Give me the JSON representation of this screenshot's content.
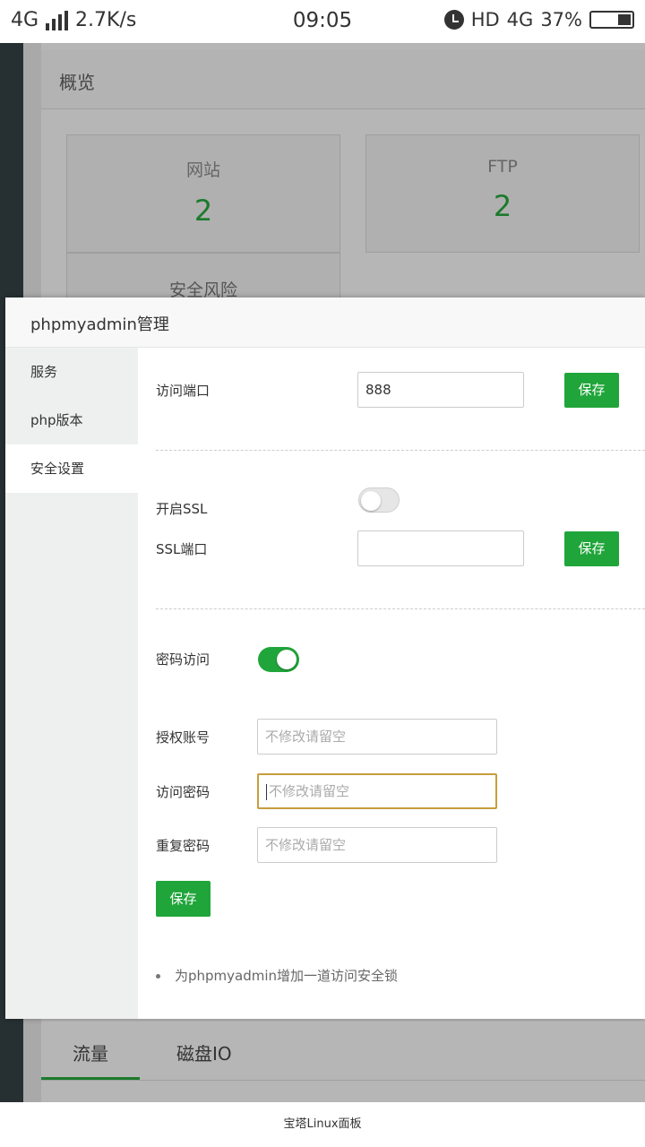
{
  "status_bar": {
    "network": "4G",
    "speed": "2.7K/s",
    "time": "09:05",
    "hd": "HD",
    "network_right": "4G",
    "battery": "37%"
  },
  "background": {
    "title": "概览",
    "cards": [
      {
        "label": "网站",
        "value": "2"
      },
      {
        "label": "FTP",
        "value": "2"
      },
      {
        "label": "安全风险"
      }
    ],
    "tabs": [
      "流量",
      "磁盘IO"
    ]
  },
  "dialog": {
    "title": "phpmyadmin管理",
    "nav": [
      "服务",
      "php版本",
      "安全设置"
    ],
    "active_nav_index": 2,
    "access_port": {
      "label": "访问端口",
      "value": "888",
      "save": "保存"
    },
    "ssl": {
      "label": "开启SSL",
      "enabled": false
    },
    "ssl_port": {
      "label": "SSL端口",
      "value": "",
      "save": "保存"
    },
    "password_access": {
      "label": "密码访问",
      "enabled": true
    },
    "auth_account": {
      "label": "授权账号",
      "placeholder": "不修改请留空"
    },
    "access_password": {
      "label": "访问密码",
      "placeholder": "不修改请留空"
    },
    "repeat_password": {
      "label": "重复密码",
      "placeholder": "不修改请留空"
    },
    "save": "保存",
    "tip": "为phpmyadmin增加一道访问安全锁"
  },
  "footer": "宝塔Linux面板",
  "colors": {
    "accent": "#20a53a",
    "focus_border": "#c79d3c"
  }
}
